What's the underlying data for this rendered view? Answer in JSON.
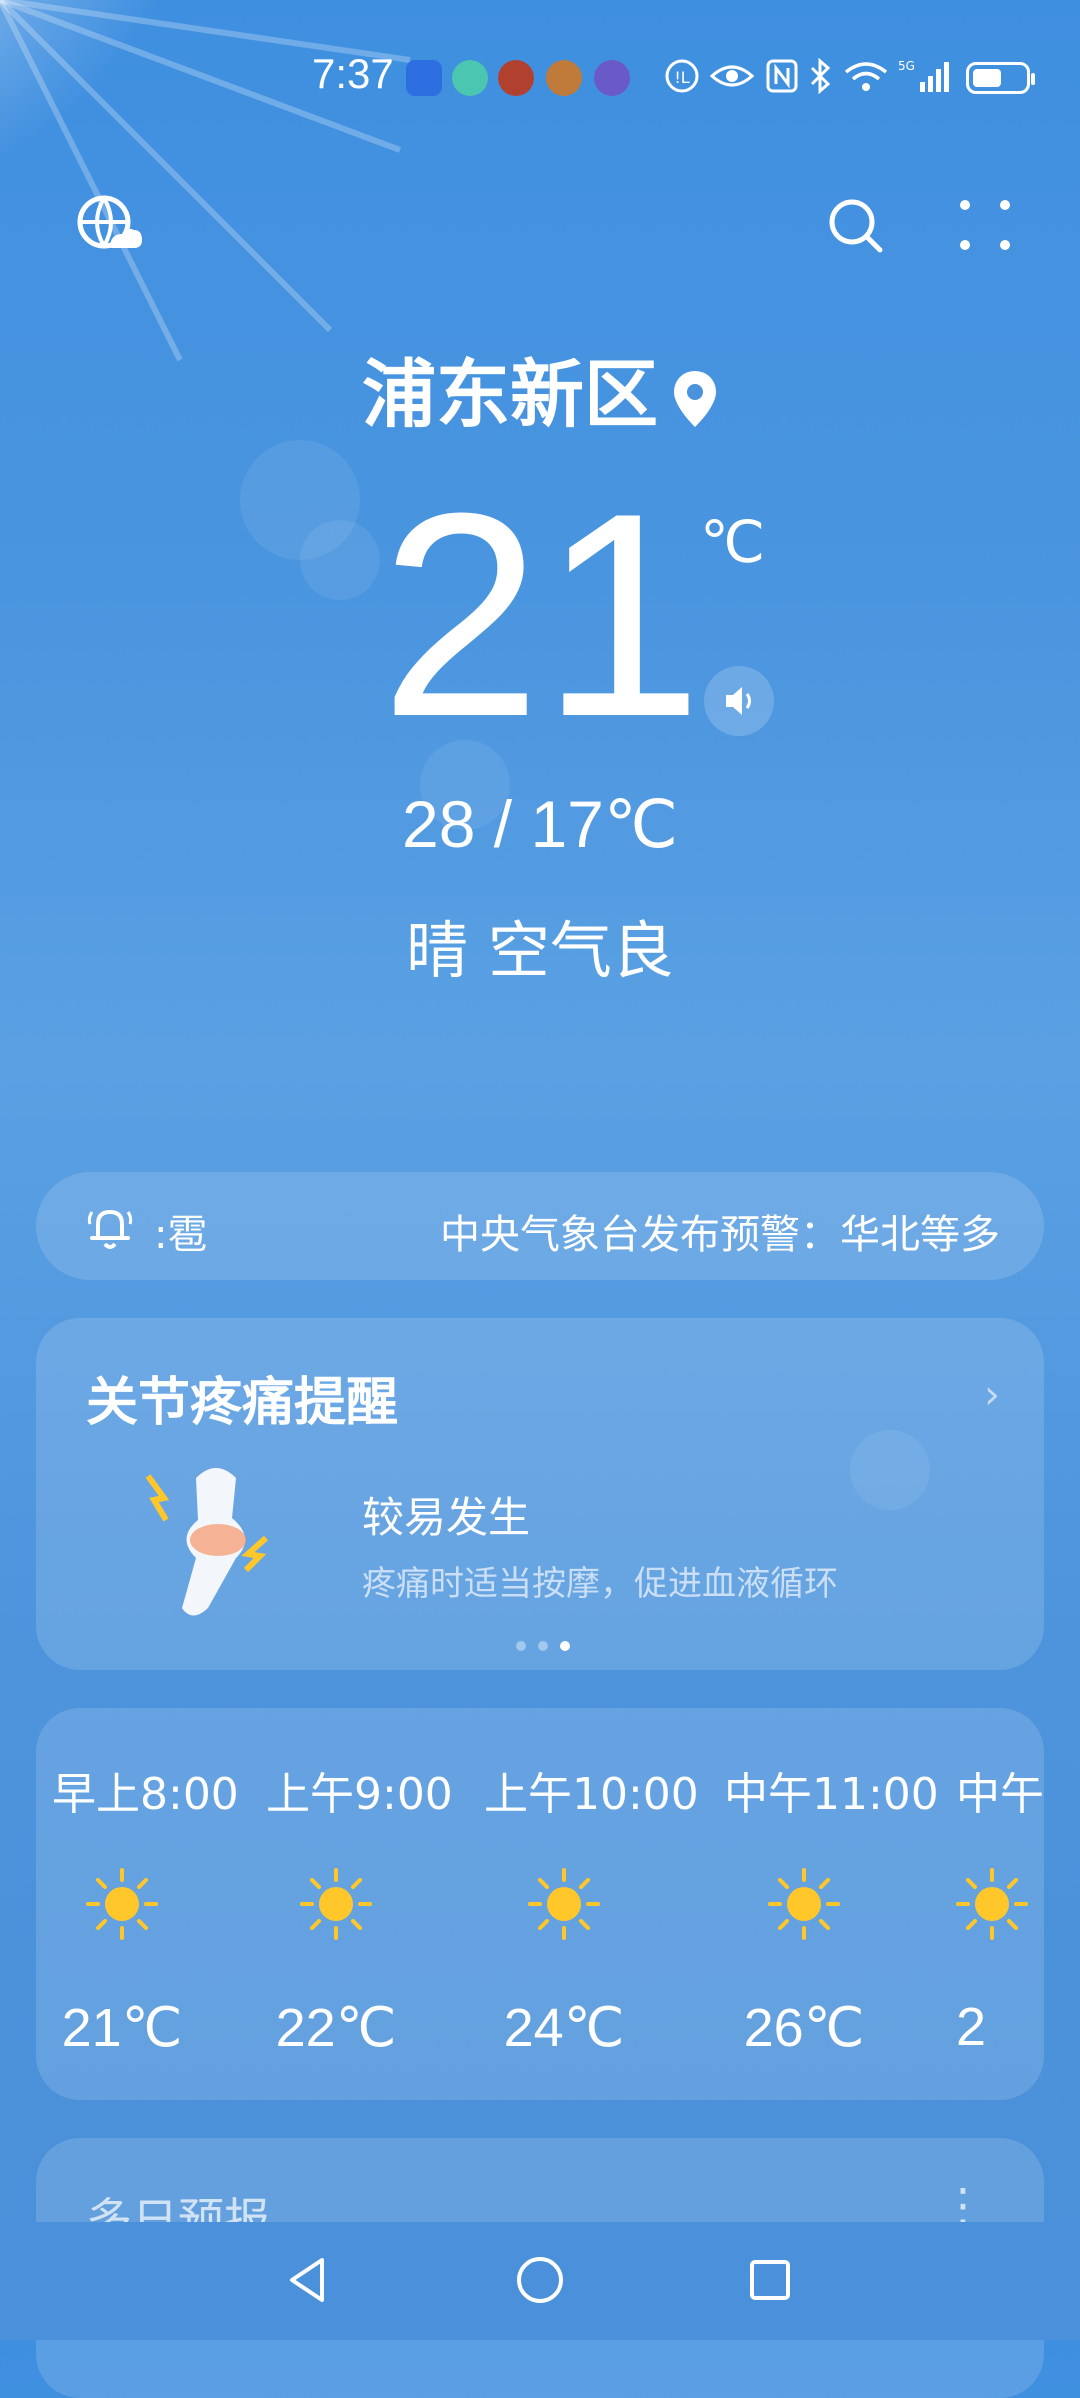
{
  "status_bar": {
    "time": "7:37",
    "battery_level": 0.5
  },
  "header": {
    "location": "浦东新区",
    "temperature": "21",
    "unit": "℃",
    "range": "28 / 17℃",
    "condition": "晴  空气良"
  },
  "alert": {
    "tag": ":雹",
    "message": "中央气象台发布预警：华北等多"
  },
  "joint_card": {
    "title": "关节疼痛提醒",
    "level": "较易发生",
    "advice": "疼痛时适当按摩，促进血液循环",
    "active_page": 3,
    "page_count": 3
  },
  "hourly": [
    {
      "time": "早上8:00",
      "temp": "21℃",
      "icon": "sun-icon"
    },
    {
      "time": "上午9:00",
      "temp": "22℃",
      "icon": "sun-icon"
    },
    {
      "time": "上午10:00",
      "temp": "24℃",
      "icon": "sun-icon"
    },
    {
      "time": "中午11:00",
      "temp": "26℃",
      "icon": "sun-icon"
    },
    {
      "time": "中午",
      "temp": "2",
      "icon": "sun-icon"
    }
  ],
  "multiday": {
    "title": "多日预报"
  },
  "colors": {
    "sun": "#ffc72a",
    "background": "#4a93dd"
  }
}
